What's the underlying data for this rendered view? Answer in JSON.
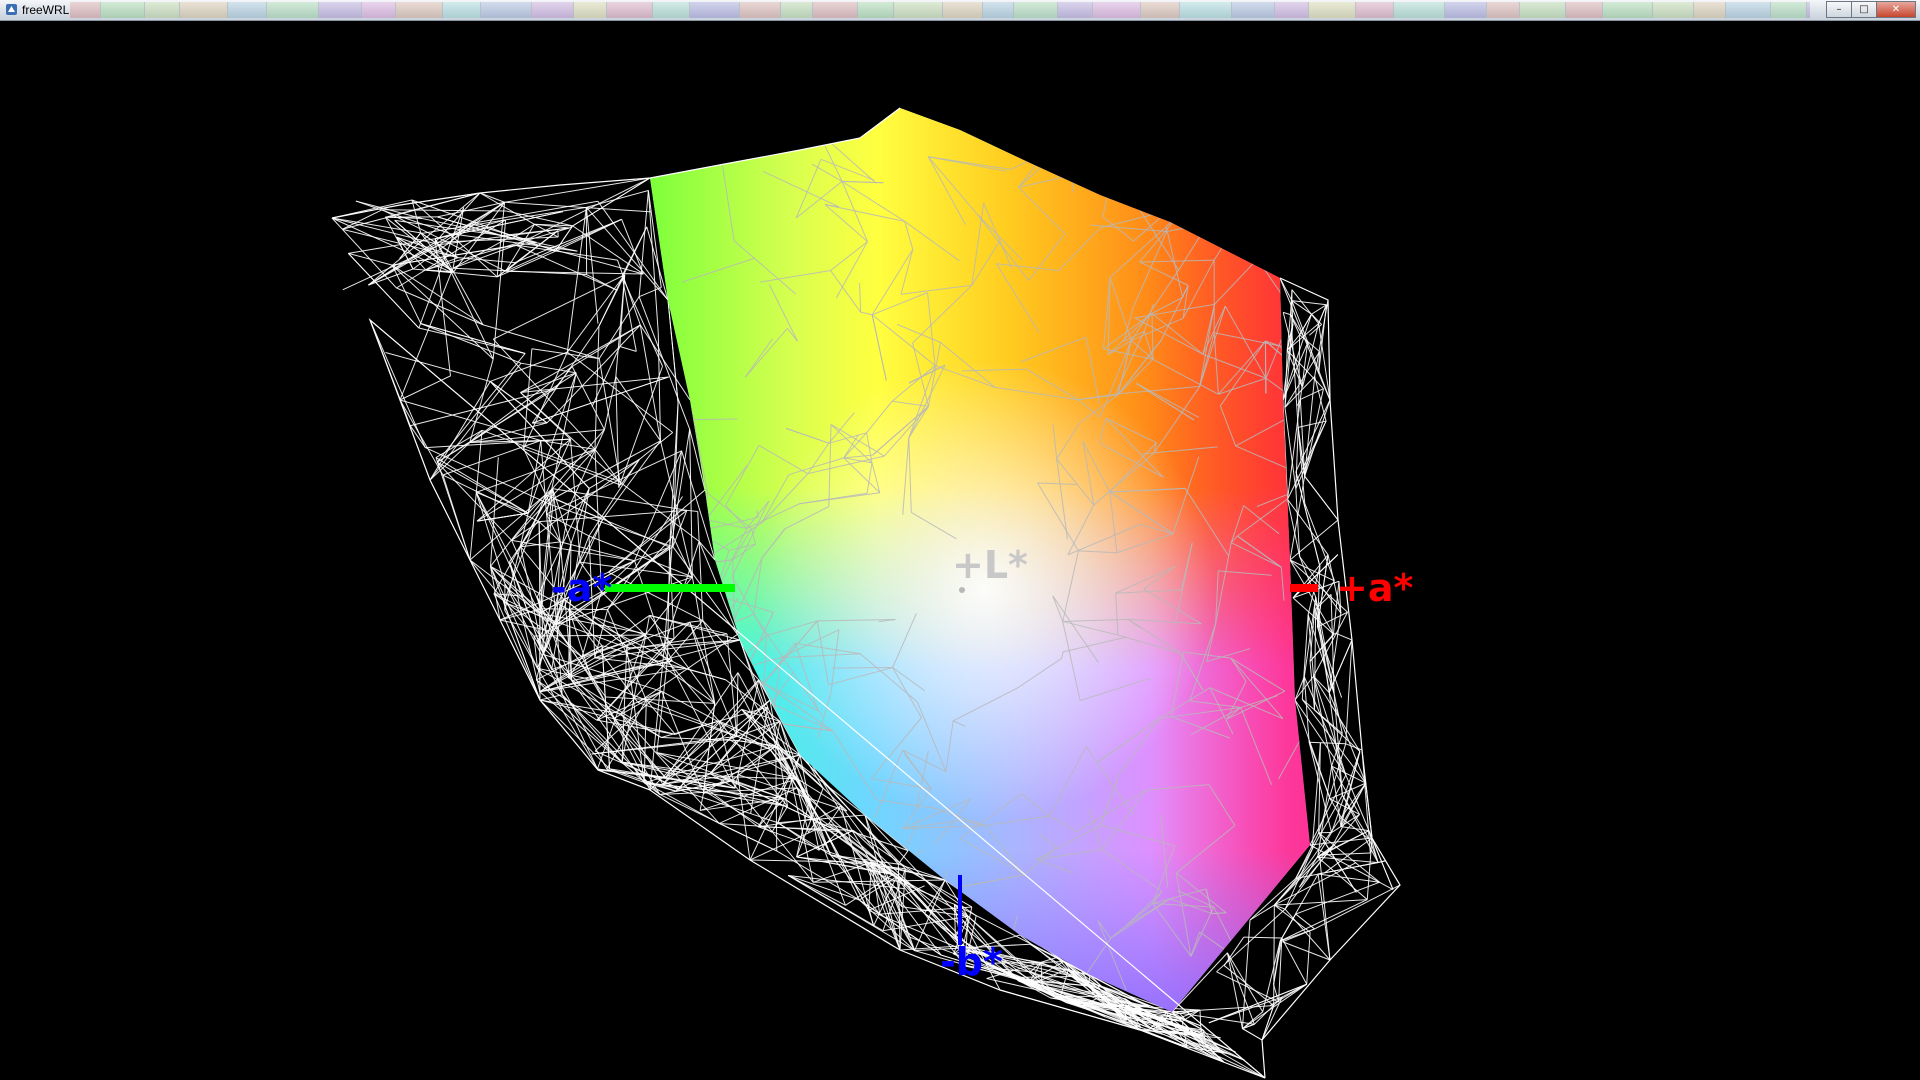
{
  "window": {
    "title": "freeWRL",
    "controls": {
      "minimize": "–",
      "maximize": "□",
      "close": "✕"
    }
  },
  "axes": {
    "neg_a_label": "-a*",
    "pos_a_label": "+a*",
    "neg_b_label": "-b*",
    "pos_l_label": "+L*"
  },
  "colors": {
    "background": "#000000",
    "wireframe": "#ffffff",
    "pos_a_axis": "#ff0000",
    "neg_a_axis": "#00ff00",
    "neg_b_axis": "#0000ff",
    "neg_a_label": "#0000ff",
    "pos_a_label": "#ff0000",
    "neg_b_label": "#0000ff",
    "pos_l_label": "#c8c8c8"
  },
  "icons": {
    "app": "freewrl-app-icon",
    "minimize": "minimize-icon",
    "maximize": "maximize-icon",
    "close": "close-icon"
  }
}
